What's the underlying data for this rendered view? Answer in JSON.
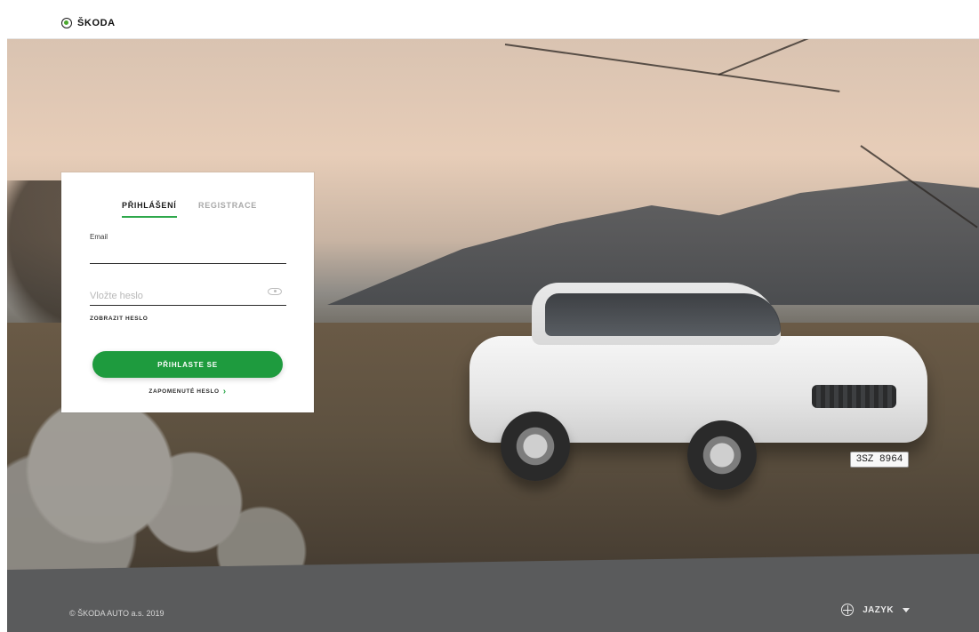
{
  "brand": {
    "name": "ŠKODA"
  },
  "tabs": [
    {
      "label": "PŘIHLÁŠENÍ",
      "active": true
    },
    {
      "label": "REGISTRACE",
      "active": false
    }
  ],
  "form": {
    "email_label": "Email",
    "email_value": "",
    "password_placeholder": "Vložte heslo",
    "show_password": "ZOBRAZIT HESLO",
    "submit": "PŘIHLASTE SE",
    "forgot": "ZAPOMENUTÉ HESLO"
  },
  "hero": {
    "plate": "3SZ 8964"
  },
  "footer": {
    "copyright": "© ŠKODA AUTO a.s. 2019",
    "language_label": "JAZYK"
  },
  "colors": {
    "accent": "#1e9b3e",
    "footer_bg": "#5a5b5c"
  },
  "icons": {
    "logo": "skoda-logo-icon",
    "eye": "eye-icon",
    "chevron": "chevron-right-icon",
    "globe": "globe-icon",
    "caret": "caret-down-icon"
  }
}
